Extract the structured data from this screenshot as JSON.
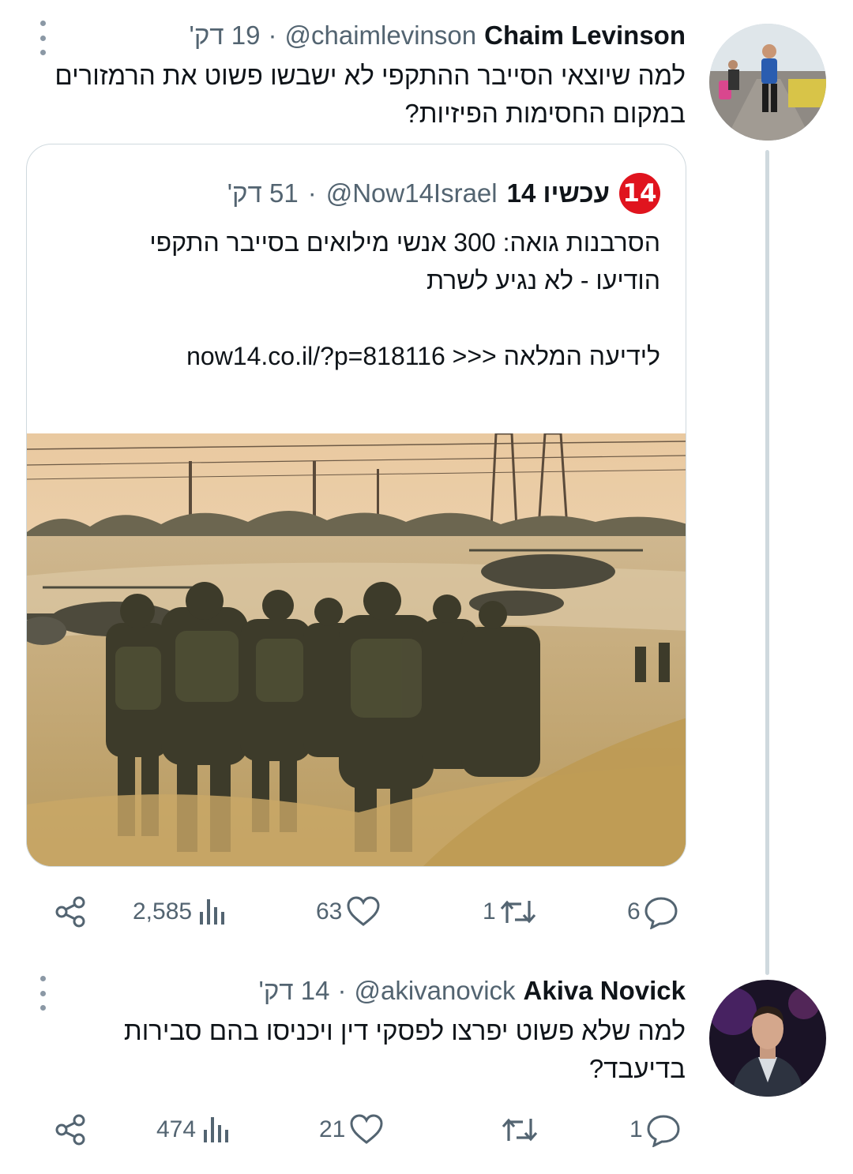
{
  "tweet1": {
    "display_name": "Chaim Levinson",
    "handle": "@chaimlevinson",
    "time": "19 דק'",
    "separator": "·",
    "text_line1": "למה שיוצאי הסייבר ההתקפי לא ישבשו פשוט את הרמזורים",
    "text_line2": "במקום החסימות הפיזיות?",
    "avatar_icon": "avatar-photo-runner",
    "quote": {
      "logo_text": "14",
      "logo_color": "#e0141e",
      "display_name": "עכשיו 14",
      "handle": "@Now14Israel",
      "time": "51 דק'",
      "separator": "·",
      "text_line1": "הסרבנות גואה: 300 אנשי מילואים בסייבר התקפי",
      "text_line2": "הודיעו - לא נגיע לשרת",
      "link_line": "לידיעה המלאה <<< now14.co.il/?p=818116",
      "ellipsis": "...",
      "image_icon": "soldiers-marching-photo"
    },
    "stats": {
      "replies": "6",
      "retweets": "1",
      "likes": "63",
      "views": "2,585"
    }
  },
  "tweet2": {
    "display_name": "Akiva Novick",
    "handle": "@akivanovick",
    "time": "14 דק'",
    "separator": "·",
    "text_line1": "למה שלא פשוט יפרצו לפסקי דין ויכניסו בהם סבירות",
    "text_line2": "בדיעבד?",
    "avatar_icon": "avatar-photo-suit",
    "stats": {
      "replies": "1",
      "retweets": "",
      "likes": "21",
      "views": "474"
    }
  },
  "colors": {
    "text": "#0f1419",
    "secondary": "#536471",
    "border": "#cfd9de",
    "brand_red": "#e0141e"
  }
}
